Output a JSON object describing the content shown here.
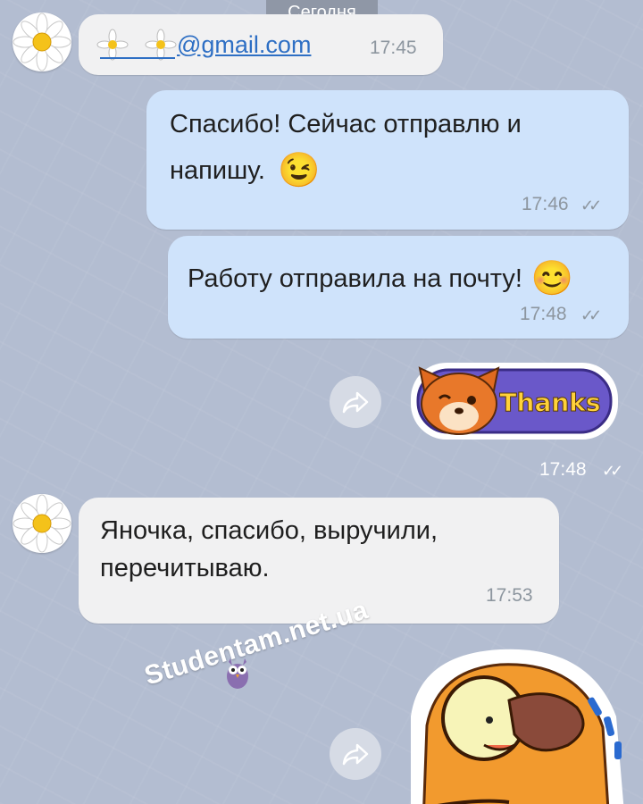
{
  "chat": {
    "date_label": "Сегодня",
    "messages": [
      {
        "text_fragment": "@gmail.com",
        "time": "17:45"
      },
      {
        "line1": "Спасибо! Сейчас отправлю и",
        "line2": "напишу.",
        "emoji": "😉",
        "time": "17:46"
      },
      {
        "text": "Работу отправила на почту!",
        "emoji": "😊",
        "time": "17:48"
      },
      {
        "sticker_label": "Thanks",
        "time": "17:48"
      },
      {
        "line1": "Яночка, спасибо, выручили,",
        "line2": "перечитываю.",
        "time": "17:53"
      }
    ]
  },
  "watermark": {
    "text": "Studentam.net.ua"
  },
  "colors": {
    "background": "#b3bdd1",
    "incoming": "#f1f1f2",
    "outgoing": "#cfe3fb"
  }
}
